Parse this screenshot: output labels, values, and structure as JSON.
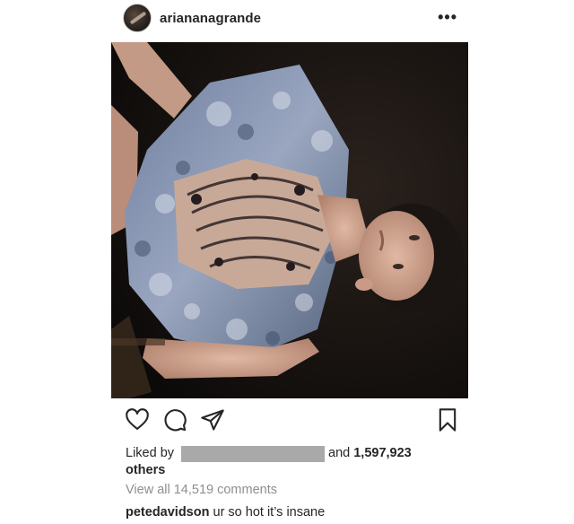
{
  "post": {
    "username": "ariananagrande",
    "more_icon": "more-horizontal-icon"
  },
  "actions": {
    "icons": [
      "heart-icon",
      "comment-icon",
      "share-icon",
      "bookmark-icon"
    ]
  },
  "likes": {
    "prefix": "Liked by",
    "suffix_and": "and",
    "count": "1,597,923",
    "others": "others"
  },
  "comments": {
    "view_all": "View all 14,519 comments",
    "items": [
      {
        "user": "petedavidson",
        "text": "ur so hot it’s insane"
      }
    ]
  }
}
